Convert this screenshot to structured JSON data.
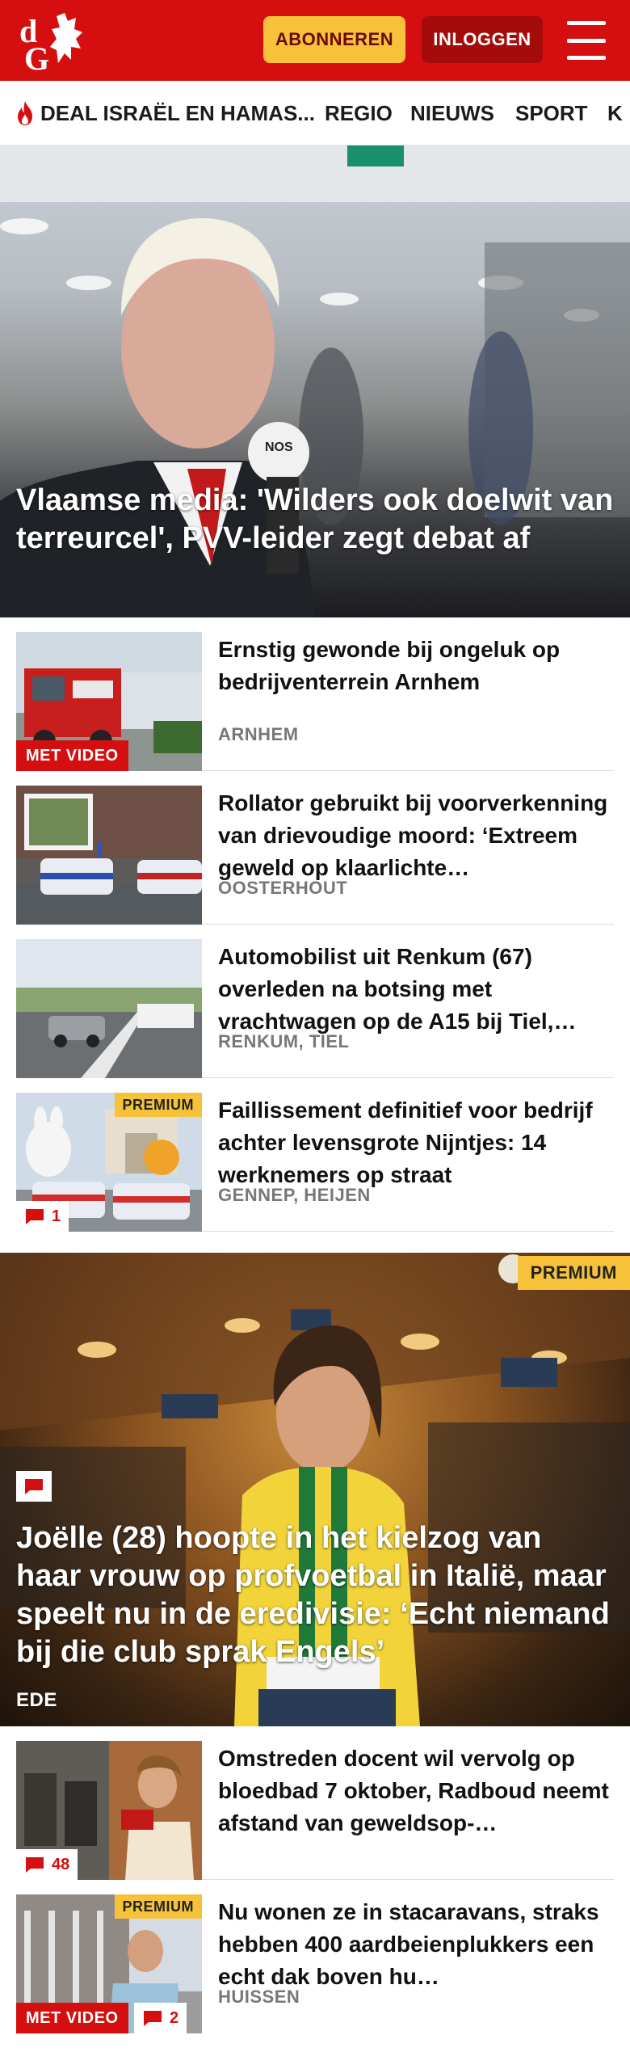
{
  "header": {
    "logo_text": "dG",
    "subscribe_label": "ABONNEREN",
    "login_label": "INLOGGEN",
    "brand_color": "#d50f0f"
  },
  "nav": {
    "items": [
      {
        "label": "DEAL ISRAËL EN HAMAS...",
        "icon": "flame-icon"
      },
      {
        "label": "REGIO"
      },
      {
        "label": "NIEUWS"
      },
      {
        "label": "SPORT"
      },
      {
        "label": "K"
      }
    ]
  },
  "hero": {
    "title": "Vlaamse media: 'Wilders ook doelwit van terreurcel', PVV-leider zegt debat af"
  },
  "articles": [
    {
      "title": "Ernstig gewonde bij ongeluk op bedrijventerrein Arnhem",
      "location": "ARNHEM",
      "video_label": "MET VIDEO"
    },
    {
      "title": "Rollator gebruikt bij voorverkenning van drievoudige moord: ‘Extreem geweld op klaarlichte…",
      "location": "OOSTERHOUT"
    },
    {
      "title": "Automobilist uit Renkum (67) overleden na botsing met vrachtwagen op de A15 bij Tiel,…",
      "location": "RENKUM, TIEL"
    },
    {
      "title": "Faillissement definitief voor bedrijf achter levensgrote Nijntjes: 14 werknemers op straat",
      "location": "GENNEP, HEIJEN",
      "premium_label": "PREMIUM",
      "comments": "1"
    }
  ],
  "feature": {
    "premium_label": "PREMIUM",
    "title": "Joëlle (28) hoopte in het kielzog van haar vrouw op profvoetbal in Italië, maar speelt nu in de eredivisie: ‘Echt niemand bij die club sprak Engels’",
    "location": "EDE"
  },
  "articles2": [
    {
      "title": "Omstreden docent wil vervolg op bloedbad 7 oktober, Radboud neemt afstand van geweldsop-…",
      "comments": "48"
    },
    {
      "title": "Nu wonen ze in stacaravans, straks hebben 400 aardbeienplukkers een echt dak boven hu…",
      "location": "HUISSEN",
      "premium_label": "PREMIUM",
      "video_label": "MET VIDEO",
      "comments": "2"
    }
  ]
}
